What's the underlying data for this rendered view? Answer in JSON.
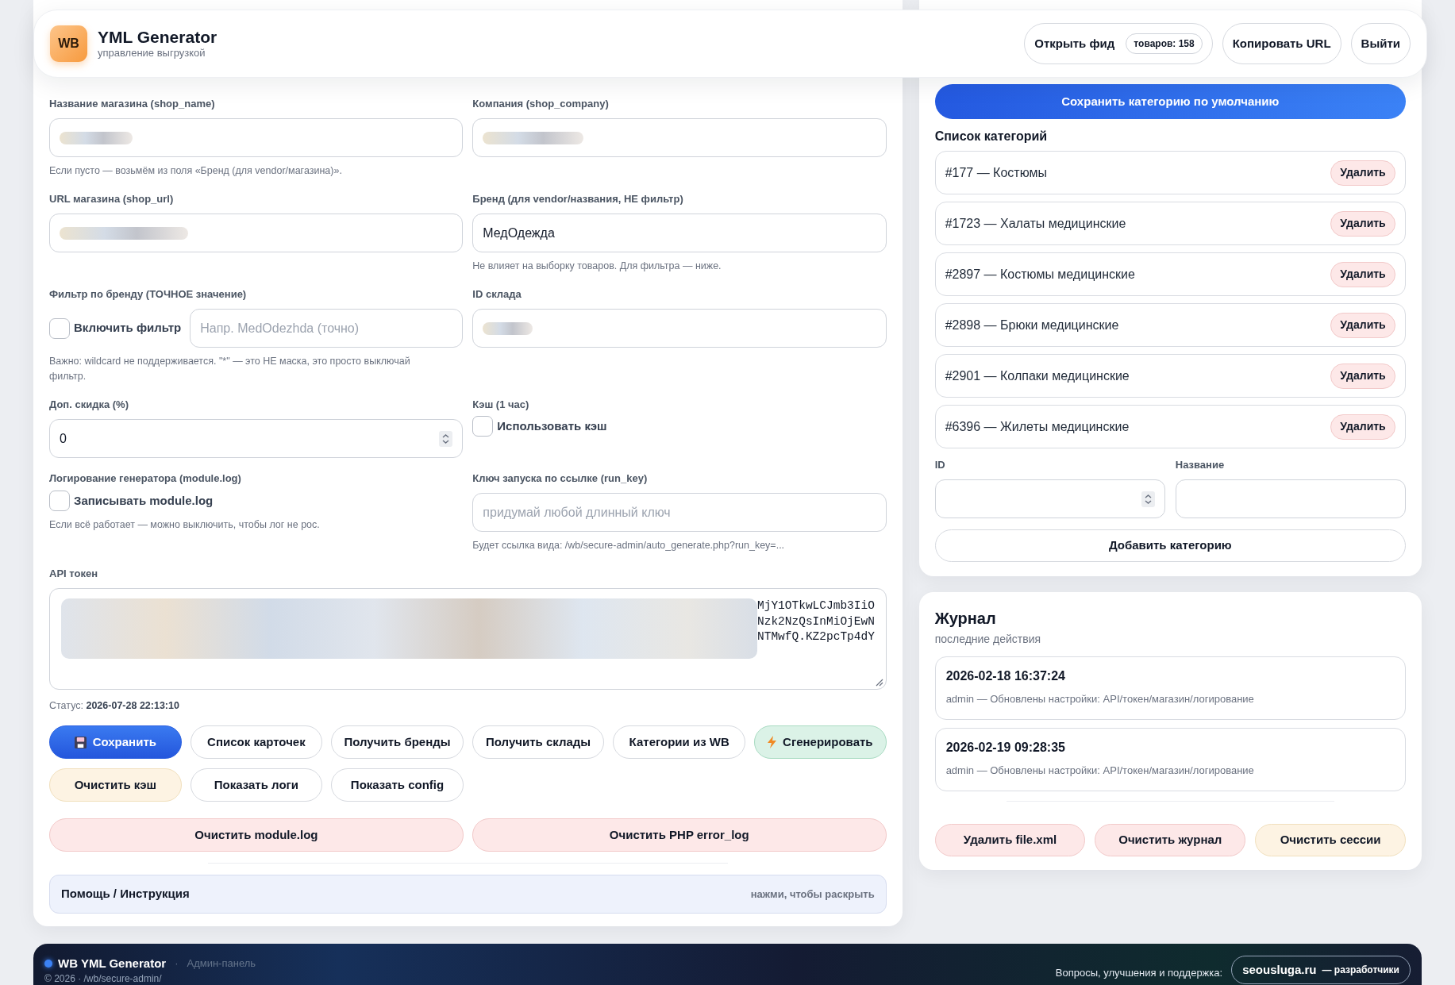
{
  "header": {
    "logo": "WB",
    "title": "YML Generator",
    "subtitle": "управление выгрузкой",
    "buttons": [
      {
        "label": "Открыть фид",
        "badge": "товаров: 158"
      },
      {
        "label": "Копировать URL"
      },
      {
        "label": "Выйти"
      }
    ]
  },
  "settings": {
    "shop_name": {
      "label": "Название магазина (shop_name)",
      "blurred": true,
      "hint": "Если пусто — возьмём из поля «Бренд (для vendor/магазина)»."
    },
    "shop_company": {
      "label": "Компания (shop_company)",
      "blurred": true
    },
    "shop_url": {
      "label": "URL магазина (shop_url)",
      "blurred": true
    },
    "brand": {
      "label": "Бренд (для vendor/названия, НЕ фильтр)",
      "value": "МедОдежда",
      "hint": "Не влияет на выборку товаров. Для фильтра — ниже."
    },
    "brand_filter": {
      "label": "Фильтр по бренду (ТОЧНОЕ значение)",
      "checkbox": {
        "label": "Включить фильтр",
        "checked": false
      },
      "placeholder": "Напр. MedOdezhda (точно)",
      "hint": "Важно: wildcard не поддерживается. \"*\" — это НЕ маска, это просто выключай фильтр."
    },
    "warehouse_id": {
      "label": "ID склада",
      "blurred": true
    },
    "discount": {
      "label": "Доп. скидка (%)",
      "value": "0"
    },
    "cache": {
      "label": "Кэш (1 час)",
      "checkbox": {
        "label": "Использовать кэш",
        "checked": false
      }
    },
    "logging": {
      "label": "Логирование генератора (module.log)",
      "checkbox": {
        "label": "Записывать module.log",
        "checked": false
      },
      "hint": "Если всё работает — можно выключить, чтобы лог не рос."
    },
    "run_key": {
      "label": "Ключ запуска по ссылке (run_key)",
      "placeholder": "придумай любой длинный ключ",
      "hint": "Будет ссылка вида: /wb/secure-admin/auto_generate.php?run_key=..."
    },
    "api_token": {
      "label": "API токен",
      "blurred": true,
      "visible_lines": [
        "MjY1OTkwLCJmb3IiO",
        "Nzk2NzQsInMiOjEwN",
        "NTMwfQ.KZ2pcTp4dY"
      ]
    },
    "status": "Статус: **2026-07-28 22:13:10**",
    "actions": [
      {
        "label": "Сохранить",
        "kind": "primary"
      },
      {
        "label": "Список карточек",
        "kind": "default"
      },
      {
        "label": "Получить бренды",
        "kind": "default"
      },
      {
        "label": "Получить склады",
        "kind": "default"
      },
      {
        "label": "Категории из WB",
        "kind": "default"
      },
      {
        "label": "Сгенерировать",
        "kind": "success"
      },
      {
        "label": "Очистить кэш",
        "kind": "warning"
      },
      {
        "label": "Показать логи",
        "kind": "default"
      },
      {
        "label": "Показать config",
        "kind": "default"
      }
    ],
    "log_actions": [
      {
        "label": "Очистить module.log",
        "kind": "danger"
      },
      {
        "label": "Очистить PHP error_log",
        "kind": "danger"
      }
    ],
    "help": {
      "title": "Помощь / Инструкция",
      "hint": "нажми, чтобы раскрыть"
    }
  },
  "categories": {
    "default_button": "Сохранить категорию по умолчанию",
    "title": "Список категорий",
    "items": [
      {
        "label": "#177 — Костюмы",
        "action": "Удалить"
      },
      {
        "label": "#1723 — Халаты медицинские",
        "action": "Удалить"
      },
      {
        "label": "#2897 — Костюмы медицинские",
        "action": "Удалить"
      },
      {
        "label": "#2898 — Брюки медицинские",
        "action": "Удалить"
      },
      {
        "label": "#2901 — Колпаки медицинские",
        "action": "Удалить"
      },
      {
        "label": "#6396 — Жилеты медицинские",
        "action": "Удалить"
      }
    ],
    "id_field": {
      "label": "ID"
    },
    "name_field": {
      "label": "Название"
    },
    "add_button": "Добавить категорию"
  },
  "journal": {
    "title": "Журнал",
    "subtitle": "последние действия",
    "entries": [
      {
        "time": "2026-02-18 16:37:24",
        "text": "admin — Обновлены настройки: API/токен/магазин/логирование"
      },
      {
        "time": "2026-02-19 09:28:35",
        "text": "admin — Обновлены настройки: API/токен/магазин/логирование"
      }
    ],
    "actions": [
      {
        "label": "Удалить file.xml",
        "kind": "danger"
      },
      {
        "label": "Очистить журнал",
        "kind": "danger"
      },
      {
        "label": "Очистить сессии",
        "kind": "warning"
      }
    ]
  },
  "footer": {
    "brand": "WB YML Generator",
    "separator": "·",
    "subtitle": "Админ-панель",
    "copyright": "© 2026 · /wb/secure-admin/",
    "support_label": "Вопросы, улучшения и поддержка:",
    "link": "seousluga.ru",
    "link_suffix": "— разработчики"
  }
}
